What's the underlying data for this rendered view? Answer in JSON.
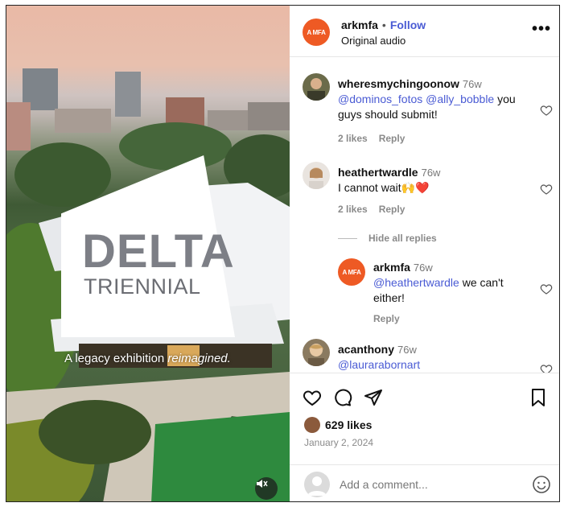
{
  "post": {
    "author": "arkmfa",
    "avatar_text": "A MFA",
    "follow_label": "Follow",
    "separator": "•",
    "audio": "Original audio",
    "more_label": "•••"
  },
  "media": {
    "logo_word": "DELTA",
    "logo_sub": "TRIENNIAL",
    "caption_plain": "A legacy exhibition ",
    "caption_italic": "reimagined."
  },
  "comments": [
    {
      "user": "wheresmychingoonow",
      "time": "76w",
      "mention1": "@dominos_fotos",
      "mention2": "@ally_bobble",
      "text_tail": " you",
      "text_line2": "guys should submit!",
      "likes": "2 likes",
      "reply_label": "Reply"
    },
    {
      "user": "heathertwardle",
      "time": "76w",
      "text": "I cannot wait🙌❤️",
      "likes": "2 likes",
      "reply_label": "Reply",
      "hide_replies": "Hide all replies",
      "replies": [
        {
          "user": "arkmfa",
          "avatar_text": "A MFA",
          "time": "76w",
          "mention": "@heathertwardle",
          "text_tail": " we can't",
          "text_line2": "either!",
          "reply_label": "Reply"
        }
      ]
    },
    {
      "user": "acanthony",
      "time": "76w",
      "mention": "@laurarabornart"
    }
  ],
  "engagement": {
    "likes": "629 likes",
    "date": "January 2, 2024"
  },
  "composer": {
    "placeholder": "Add a comment..."
  },
  "colors": {
    "accent": "#4a5bd4",
    "brand": "#ee5a24",
    "heart_red": "#e0245e"
  }
}
